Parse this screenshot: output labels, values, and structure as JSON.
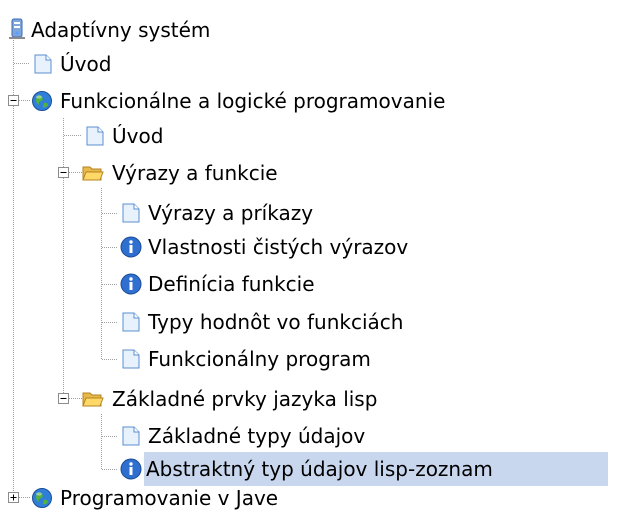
{
  "tree": {
    "root": {
      "label": "Adaptívny systém",
      "icon": "server-icon"
    },
    "items": [
      {
        "label": "Úvod",
        "icon": "page-icon"
      },
      {
        "label": "Funkcionálne a logické programovanie",
        "icon": "globe-icon",
        "toggle": "minus"
      },
      {
        "label": "Úvod",
        "icon": "page-icon"
      },
      {
        "label": "Výrazy a funkcie",
        "icon": "folder-open-icon",
        "toggle": "minus"
      },
      {
        "label": "Výrazy a príkazy",
        "icon": "page-icon"
      },
      {
        "label": "Vlastnosti čistých výrazov",
        "icon": "info-icon"
      },
      {
        "label": "Definícia funkcie",
        "icon": "info-icon"
      },
      {
        "label": "Typy hodnôt vo funkciách",
        "icon": "page-icon"
      },
      {
        "label": "Funkcionálny program",
        "icon": "page-icon"
      },
      {
        "label": "Základné prvky jazyka lisp",
        "icon": "folder-open-icon",
        "toggle": "minus"
      },
      {
        "label": "Základné typy údajov",
        "icon": "page-icon"
      },
      {
        "label": "Abstraktný typ údajov lisp-zoznam",
        "icon": "info-icon",
        "selected": true
      },
      {
        "label": "Programovanie v Jave",
        "icon": "globe-icon",
        "toggle": "plus"
      }
    ]
  },
  "colors": {
    "selection": "#c9d7ee",
    "tree_lines": "#9c9c9c",
    "text": "#000000"
  }
}
